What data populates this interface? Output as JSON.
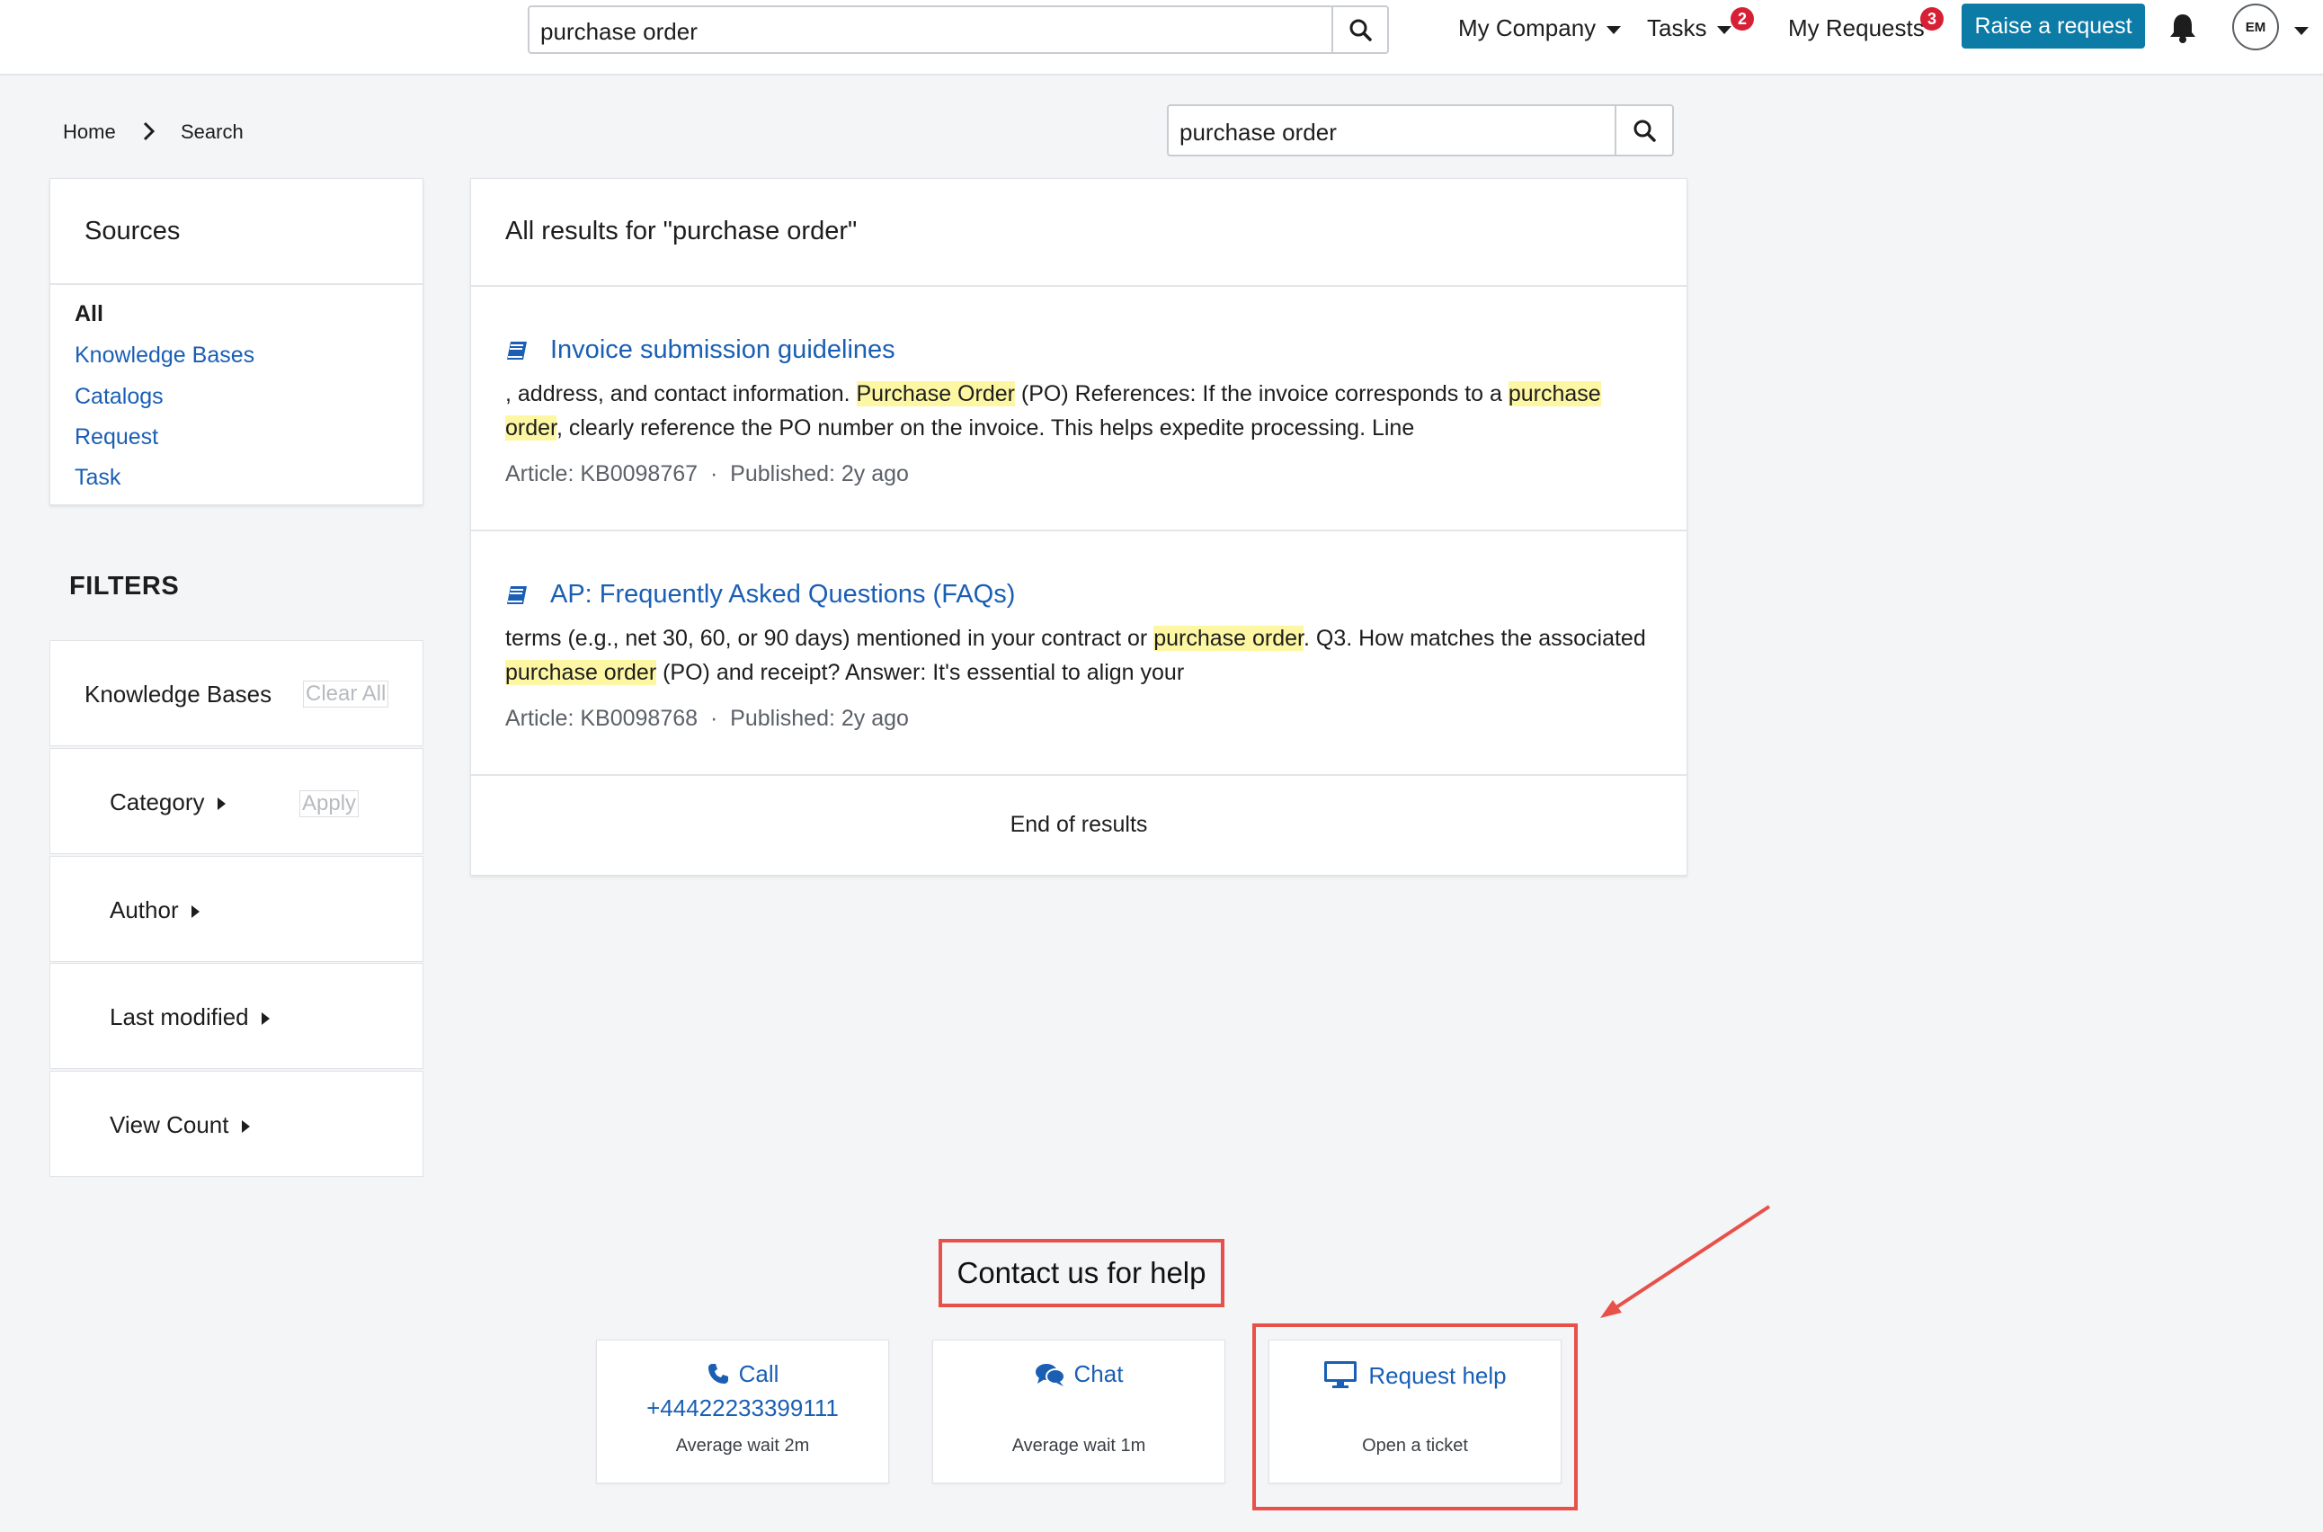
{
  "header": {
    "search_value": "purchase order",
    "nav": {
      "my_company": "My Company",
      "tasks": "Tasks",
      "tasks_badge": "2",
      "my_requests": "My Requests",
      "my_requests_badge": "3",
      "raise_request": "Raise a request"
    },
    "avatar_initials": "EM"
  },
  "breadcrumb": {
    "home": "Home",
    "current": "Search"
  },
  "content_search": {
    "value": "purchase order"
  },
  "sources": {
    "title": "Sources",
    "items": [
      {
        "label": "All",
        "active": true
      },
      {
        "label": "Knowledge Bases"
      },
      {
        "label": "Catalogs"
      },
      {
        "label": "Request"
      },
      {
        "label": "Task"
      }
    ]
  },
  "filters": {
    "heading": "FILTERS",
    "group_title": "Knowledge Bases",
    "clear_all": "Clear All",
    "apply": "Apply",
    "items": [
      "Category",
      "Author",
      "Last modified",
      "View Count"
    ]
  },
  "results": {
    "heading": "All results for \"purchase order\"",
    "items": [
      {
        "title": "Invoice submission guidelines",
        "snippet_parts": [
          ", address, and contact information. ",
          "Purchase Order",
          " (PO) References: If the invoice corresponds to a ",
          "purchase",
          "order",
          ", clearly reference the PO number on the invoice. This helps expedite processing. Line"
        ],
        "article": "Article: KB0098767",
        "published": "Published: 2y ago"
      },
      {
        "title": "AP: Frequently Asked Questions (FAQs)",
        "snippet_parts": [
          "terms (e.g., net 30, 60, or 90 days) mentioned in your contract or ",
          "purchase order",
          ". Q3. How matches the associated",
          "purchase order",
          " (PO) and receipt? Answer: It's essential to align your"
        ],
        "article": "Article: KB0098768",
        "published": "Published: 2y ago"
      }
    ],
    "end_text": "End of results",
    "separator": "·"
  },
  "contact": {
    "title": "Contact us for help",
    "cards": [
      {
        "title": "Call",
        "detail": "+44422233399111",
        "sub": "Average wait 2m",
        "icon": "phone-icon"
      },
      {
        "title": "Chat",
        "sub": "Average wait 1m",
        "icon": "chat-icon"
      },
      {
        "title": "Request help",
        "sub": "Open a ticket",
        "icon": "monitor-icon"
      }
    ]
  },
  "colors": {
    "accent": "#0c7ba6",
    "link": "#1a5fb4",
    "badge": "#d72035",
    "highlight": "#fdf7a3",
    "annotation": "#e8504a"
  }
}
